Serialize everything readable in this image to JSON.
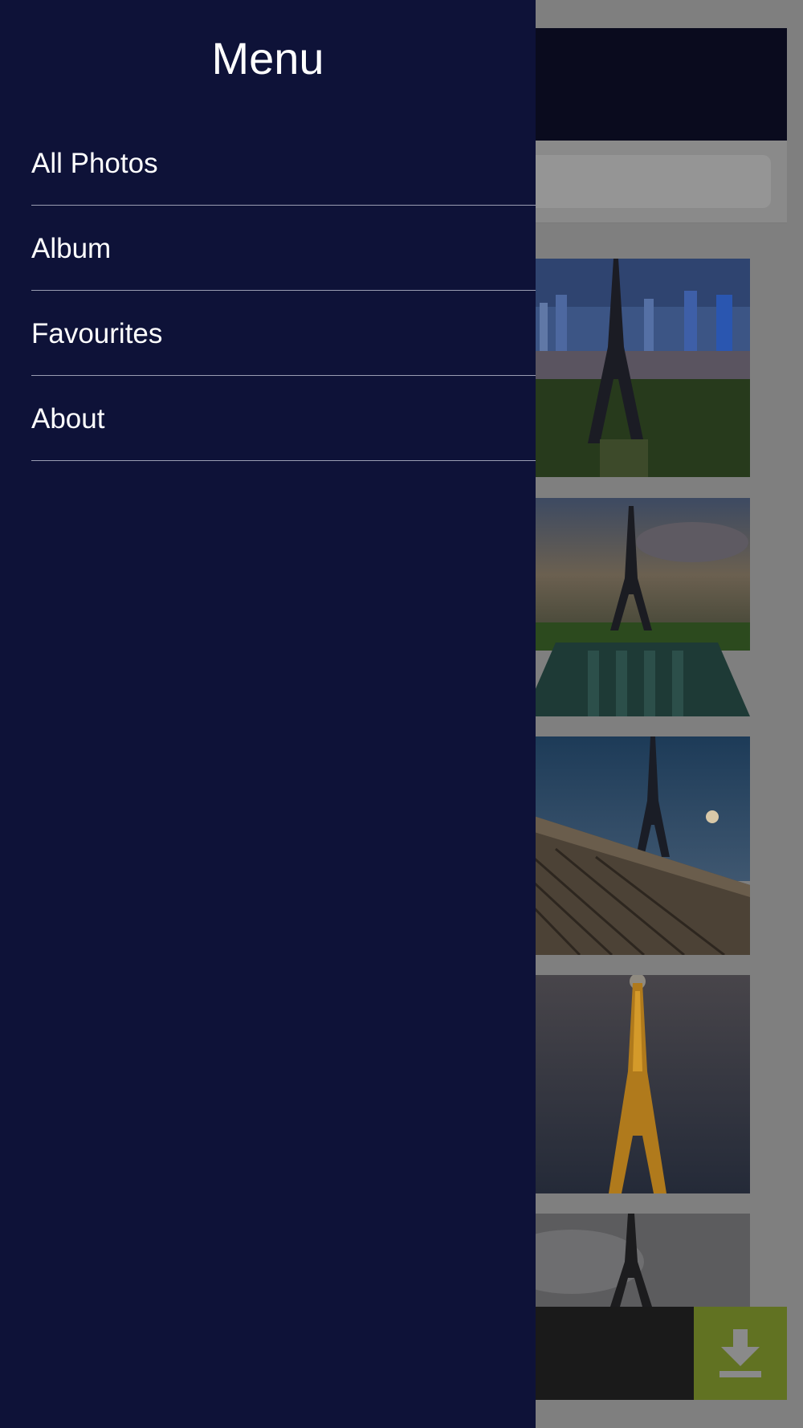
{
  "drawer": {
    "title": "Menu",
    "items": [
      {
        "label": "All Photos"
      },
      {
        "label": "Album"
      },
      {
        "label": "Favourites"
      },
      {
        "label": "About"
      }
    ]
  },
  "app": {
    "photos": [
      {
        "name": "eiffel-tower-city-skyline"
      },
      {
        "name": "eiffel-tower-sunset-fountain"
      },
      {
        "name": "eiffel-tower-trocadero-steps"
      },
      {
        "name": "eiffel-tower-night-lights"
      },
      {
        "name": "eiffel-tower-cloudy"
      }
    ],
    "download_icon": "download-arrow-icon"
  },
  "colors": {
    "drawer_bg": "#0e1238",
    "overlay_dim": "#7f7f7f",
    "download_accent": "#617222",
    "divider": "#9a9db3",
    "text": "#ffffff"
  }
}
